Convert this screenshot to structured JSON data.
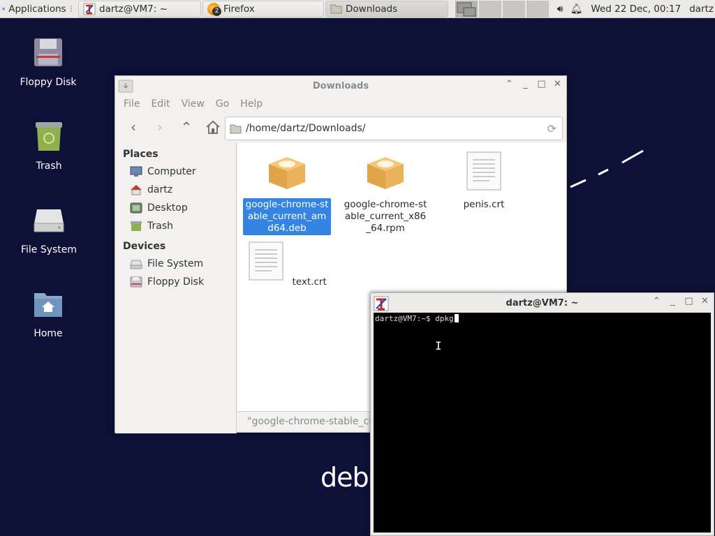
{
  "panel": {
    "applications_label": "Applications",
    "tasks": [
      {
        "label": "dartz@VM7: ~",
        "icon": "terminal-icon"
      },
      {
        "label": "Firefox",
        "icon": "firefox-icon",
        "badge": "2"
      },
      {
        "label": "Downloads",
        "icon": "folder-icon"
      }
    ],
    "clock": "Wed 22 Dec, 00:17",
    "user": "dartz"
  },
  "desktop": {
    "icons": [
      {
        "label": "Floppy Disk",
        "icon": "floppy-icon"
      },
      {
        "label": "Trash",
        "icon": "trash-icon"
      },
      {
        "label": "File System",
        "icon": "drive-icon"
      },
      {
        "label": "Home",
        "icon": "home-folder-icon"
      }
    ],
    "wallpaper_text": "debia"
  },
  "file_manager": {
    "title": "Downloads",
    "menu": [
      "File",
      "Edit",
      "View",
      "Go",
      "Help"
    ],
    "location": "/home/dartz/Downloads/",
    "places_heading": "Places",
    "places": [
      "Computer",
      "dartz",
      "Desktop",
      "Trash"
    ],
    "devices_heading": "Devices",
    "devices": [
      "File System",
      "Floppy Disk"
    ],
    "files": [
      {
        "name": "google-chrome-stable_current_amd64.deb",
        "icon": "package-icon",
        "selected": true
      },
      {
        "name": "google-chrome-stable_current_x86_64.rpm",
        "icon": "package-icon",
        "selected": false
      },
      {
        "name": "penis.crt",
        "icon": "text-file-icon",
        "selected": false
      },
      {
        "name": "text.crt",
        "icon": "text-file-icon",
        "selected": false
      }
    ],
    "status": "\"google-chrome-stable_cur"
  },
  "terminal": {
    "title": "dartz@VM7: ~",
    "prompt": "dartz@VM7:~$ ",
    "command": "dpkg"
  },
  "colors": {
    "desktop_bg": "#0d1137",
    "selection": "#3584e4",
    "terminal_bg": "#000000"
  }
}
